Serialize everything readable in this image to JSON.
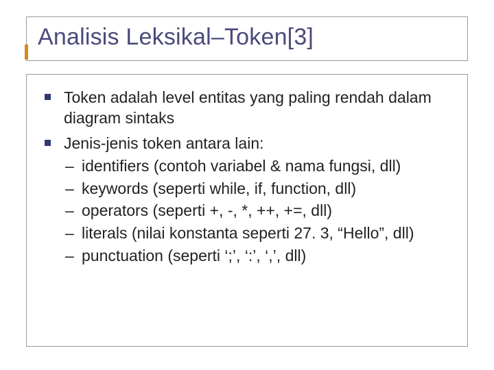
{
  "title": "Analisis Leksikal–Token[3]",
  "bullets": [
    {
      "text": "Token adalah level entitas yang paling rendah dalam diagram sintaks",
      "sub": []
    },
    {
      "text": "Jenis-jenis token antara lain:",
      "sub": [
        "identifiers (contoh variabel & nama fungsi, dll)",
        "keywords (seperti while, if, function, dll)",
        "operators (seperti +, -, *, ++, +=, dll)",
        "literals (nilai konstanta seperti 27. 3, “Hello”, dll)",
        "punctuation (seperti ‘;’, ‘:’, ‘,’, dll)"
      ]
    }
  ]
}
